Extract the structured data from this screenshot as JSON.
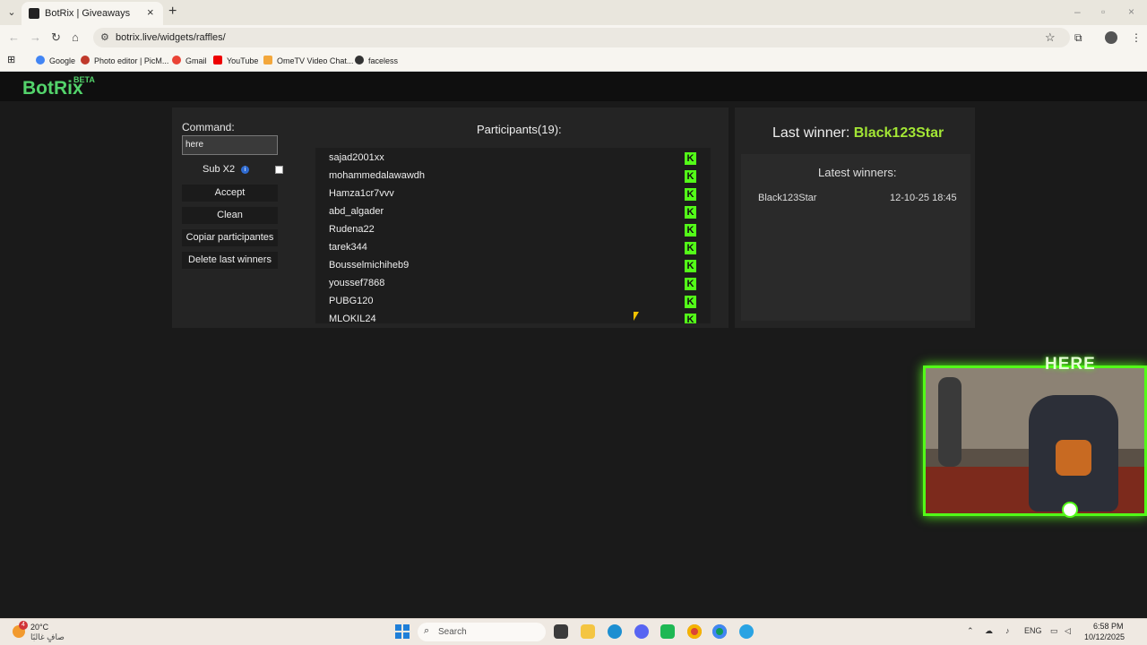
{
  "browser": {
    "tab_title": "BotRix | Giveaways",
    "url": "botrix.live/widgets/raffles/",
    "bookmarks": [
      "Google",
      "Photo editor | PicM...",
      "Gmail",
      "YouTube",
      "OmeTV Video Chat...",
      "faceless"
    ]
  },
  "app": {
    "logo": "BotRix",
    "beta": "BETA"
  },
  "controls": {
    "command_label": "Command:",
    "command_value": "here",
    "sub_label": "Sub X2",
    "buttons": {
      "accept": "Accept",
      "clean": "Clean",
      "copy": "Copiar participantes",
      "delete": "Delete last winners"
    }
  },
  "participants": {
    "title": "Participants(19):",
    "names": [
      "sajad2001xx",
      "mohammedalawawdh",
      "Hamza1cr7vvv",
      "abd_algader",
      "Rudena22",
      "tarek344",
      "Bousselmichiheb9",
      "youssef7868",
      "PUBG120",
      "MLOKIL24"
    ],
    "platform_icon": "K"
  },
  "winners": {
    "last_label": "Last winner:",
    "last_name": "Black123Star",
    "latest_title": "Latest winners:",
    "list": [
      {
        "name": "Black123Star",
        "date": "12-10-25 18:45"
      }
    ]
  },
  "overlay": {
    "label": "HERE"
  },
  "taskbar": {
    "weather_badge": "4",
    "temp": "20°C",
    "weather_desc": "صافٍ غالبًا",
    "search_placeholder": "Search",
    "lang": "ENG",
    "time": "6:58 PM",
    "date": "10/12/2025"
  },
  "colors": {
    "brand_green": "#53d36b",
    "kick_green": "#53fc18",
    "winner_green": "#a3e635"
  }
}
